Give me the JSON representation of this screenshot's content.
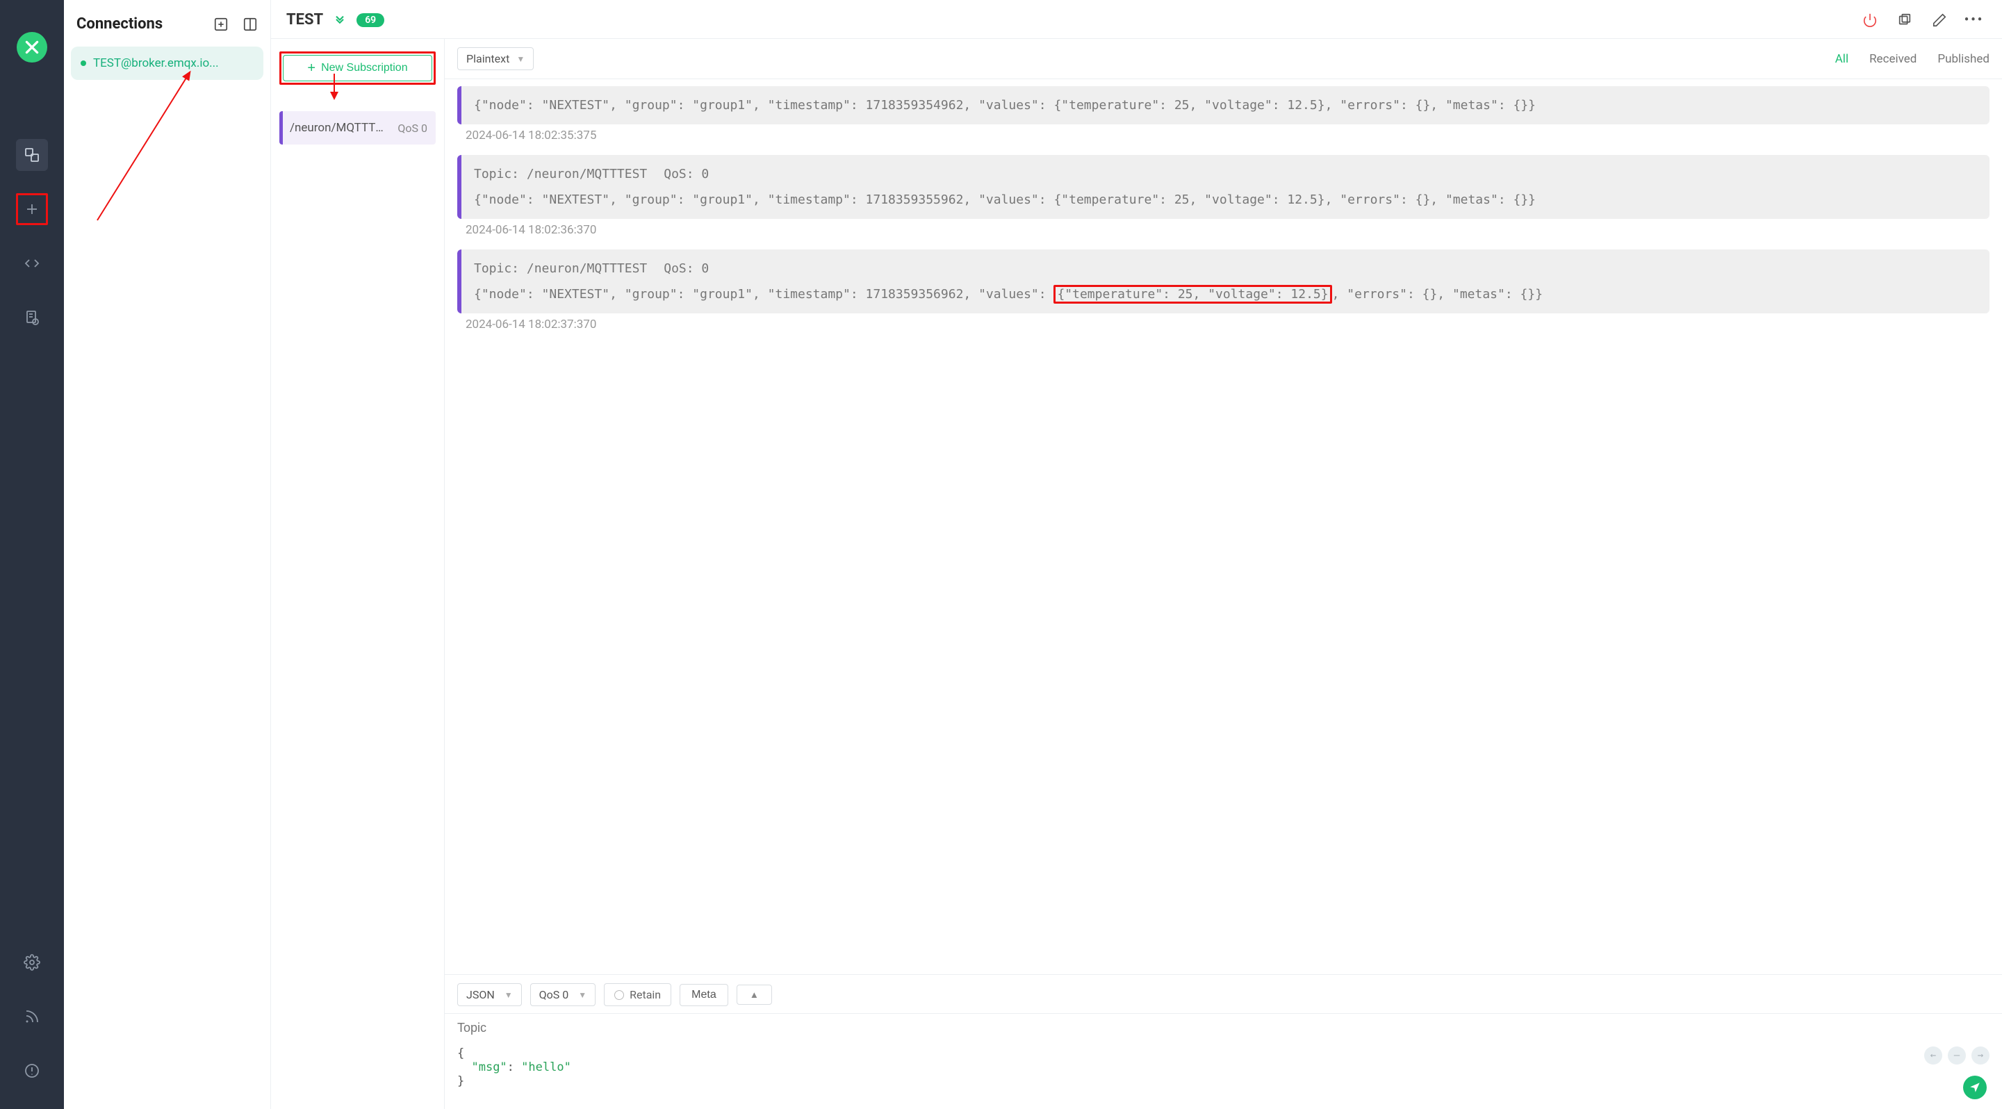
{
  "sidebar": {
    "title": "Connections",
    "items": [
      {
        "name": "TEST@broker.emqx.io..."
      }
    ]
  },
  "header": {
    "connection_name": "TEST",
    "message_count": "69"
  },
  "subscriptions": {
    "new_label": "New Subscription",
    "items": [
      {
        "topic": "/neuron/MQTTTE...",
        "qos": "QoS 0"
      }
    ]
  },
  "messages_toolbar": {
    "format": "Plaintext",
    "tabs": {
      "all": "All",
      "received": "Received",
      "published": "Published"
    }
  },
  "messages": [
    {
      "body": "{\"node\": \"NEXTEST\", \"group\": \"group1\", \"timestamp\": 1718359354962, \"values\": {\"temperature\": 25, \"voltage\": 12.5}, \"errors\": {}, \"metas\": {}}",
      "time": "2024-06-14 18:02:35:375"
    },
    {
      "topic_label": "Topic: /neuron/MQTTTEST",
      "qos_label": "QoS: 0",
      "body": "{\"node\": \"NEXTEST\", \"group\": \"group1\", \"timestamp\": 1718359355962, \"values\": {\"temperature\": 25, \"voltage\": 12.5}, \"errors\": {}, \"metas\": {}}",
      "time": "2024-06-14 18:02:36:370"
    },
    {
      "topic_label": "Topic: /neuron/MQTTTEST",
      "qos_label": "QoS: 0",
      "body_pre": "{\"node\": \"NEXTEST\", \"group\": \"group1\", \"timestamp\": 1718359356962, \"values\": ",
      "body_hl": "{\"temperature\": 25, \"voltage\": 12.5}",
      "body_post": ", \"errors\": {}, \"metas\": {}}",
      "time": "2024-06-14 18:02:37:370"
    }
  ],
  "publish": {
    "payload_format": "JSON",
    "qos": "QoS 0",
    "retain_label": "Retain",
    "meta_label": "Meta",
    "topic_placeholder": "Topic",
    "payload_key": "\"msg\"",
    "payload_val": "\"hello\"",
    "collapse_icon": "▲"
  }
}
